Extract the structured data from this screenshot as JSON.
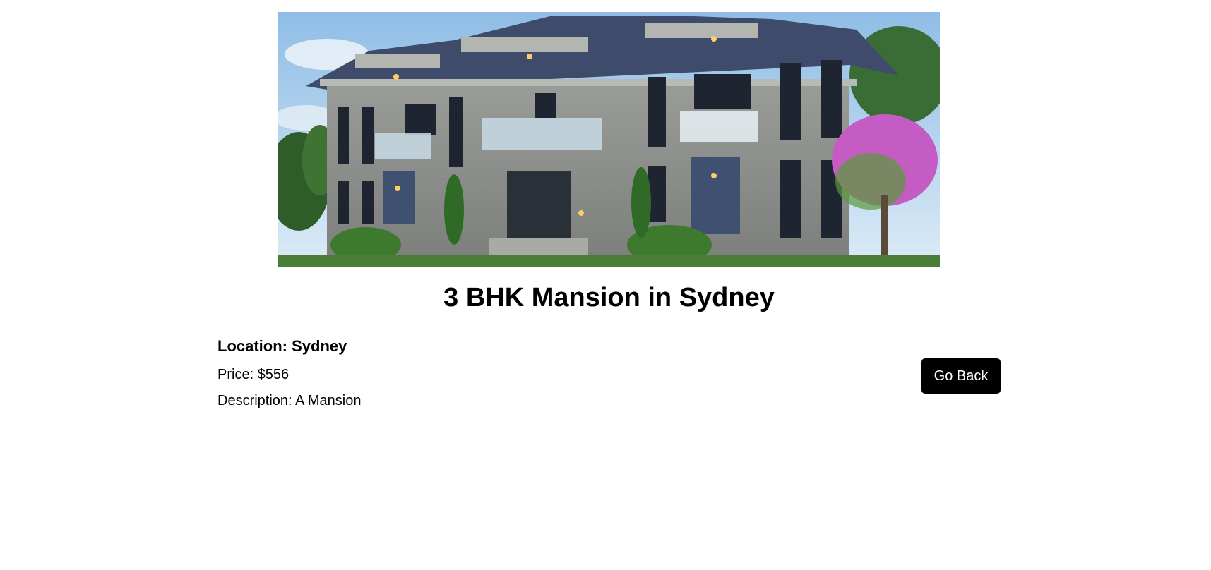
{
  "property": {
    "image_alt": "mansion-photo",
    "title": "3 BHK Mansion in Sydney",
    "location": "Location: Sydney",
    "price": "Price: $556",
    "description": "Description: A Mansion"
  },
  "actions": {
    "back_label": "Go Back"
  },
  "colors": {
    "button_bg": "#000000",
    "button_text": "#ffffff"
  }
}
